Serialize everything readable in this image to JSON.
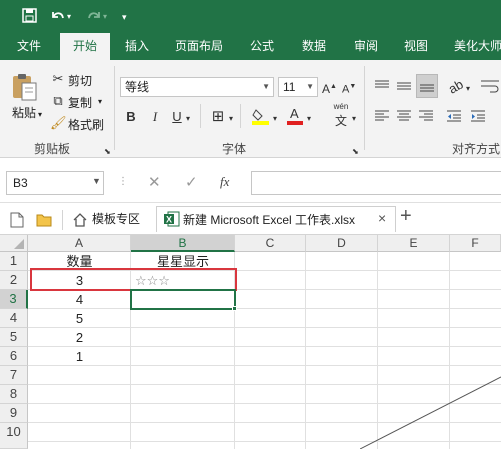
{
  "quick_access": {
    "save_icon": "save-icon",
    "undo_icon": "undo-icon",
    "redo_icon": "redo-icon",
    "customize_icon": "customize-icon"
  },
  "ribbon_tabs": [
    "文件",
    "开始",
    "插入",
    "页面布局",
    "公式",
    "数据",
    "审阅",
    "视图",
    "美化大师"
  ],
  "active_tab": "开始",
  "clipboard": {
    "paste": "粘贴",
    "cut": "剪切",
    "copy": "复制",
    "format_painter": "格式刷",
    "group_label": "剪贴板"
  },
  "font": {
    "name": "等线",
    "size": "11",
    "group_label": "字体",
    "bold": "B",
    "italic": "I",
    "underline": "U",
    "phonetic": "wén"
  },
  "alignment": {
    "group_label": "对齐方式"
  },
  "name_box": "B3",
  "formula_bar": {
    "cancel": "✕",
    "confirm": "✓",
    "fx": "fx",
    "value": ""
  },
  "doc_tabs": [
    {
      "label": "模板专区",
      "active": false
    },
    {
      "label": "新建 Microsoft Excel 工作表.xlsx",
      "active": true
    }
  ],
  "doc_tab_close": "×",
  "doc_tab_add": "+",
  "columns": [
    "A",
    "B",
    "C",
    "D",
    "E",
    "F"
  ],
  "selected_column": "B",
  "rows": [
    "1",
    "2",
    "3",
    "4",
    "5",
    "6",
    "7",
    "8",
    "9",
    "10"
  ],
  "selected_row": "3",
  "cells": {
    "A1": "数量",
    "B1": "星星显示",
    "A2": "3",
    "B2": "☆☆☆",
    "A3": "4",
    "A4": "5",
    "A5": "2",
    "A6": "1"
  },
  "colors": {
    "brand": "#217346",
    "highlight_border": "#d9363e",
    "selection": "#217346"
  }
}
